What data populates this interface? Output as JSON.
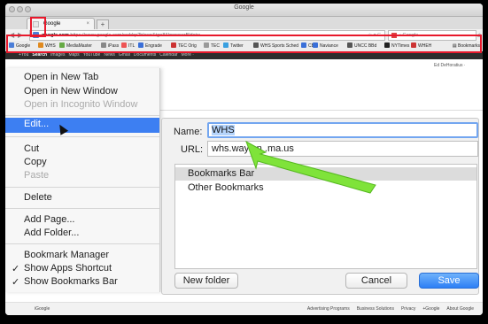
{
  "window": {
    "title": "Google"
  },
  "tabs": [
    {
      "label": "Google",
      "close": "×"
    }
  ],
  "new_tab_label": "+",
  "toolbar": {
    "back": "◀",
    "forward": "▶",
    "url_prefix": "google.com",
    "url_rest": "https://www.google.com/webhp?hl=en&tg=8&browserBld=iw",
    "url_controls": "☆ ▾ C",
    "search_placeholder": "• Google",
    "search_icon": "🔍",
    "home_icon": "⌂"
  },
  "bookmarks": [
    {
      "label": "Google",
      "color": "#4a7ed8"
    },
    {
      "label": "WHS",
      "color": "#e08a1f"
    },
    {
      "label": "MediaMaster",
      "color": "#6a4"
    },
    {
      "label": "iPass",
      "color": "#888"
    },
    {
      "label": "ITL",
      "color": "#e55"
    },
    {
      "label": "Engrade",
      "color": "#3a6fd8"
    },
    {
      "label": "TEC Orig",
      "color": "#c33"
    },
    {
      "label": "TEC",
      "color": "#999"
    },
    {
      "label": "Twitter",
      "color": "#3aa0e0"
    },
    {
      "label": "WHS Sports Sched",
      "color": "#555"
    },
    {
      "label": "CB",
      "color": "#3a6fd8"
    },
    {
      "label": "Naviance",
      "color": "#3a6fd8"
    },
    {
      "label": "UNCC BBd",
      "color": "#555"
    },
    {
      "label": "NYTimes",
      "color": "#222"
    },
    {
      "label": "WHEH",
      "color": "#c33"
    }
  ],
  "bookmarks_all": "Bookmarks",
  "google_bar": [
    "+You",
    "Search",
    "Images",
    "Maps",
    "YouTube",
    "News",
    "Gmail",
    "Documents",
    "Calendar",
    "More ·"
  ],
  "user_name": "Ed DeHoratius ·",
  "context_menu": {
    "open_new_tab": "Open in New Tab",
    "open_new_window": "Open in New Window",
    "open_incognito": "Open in Incognito Window",
    "edit": "Edit...",
    "cut": "Cut",
    "copy": "Copy",
    "paste": "Paste",
    "delete": "Delete",
    "add_page": "Add Page...",
    "add_folder": "Add Folder...",
    "bookmark_manager": "Bookmark Manager",
    "show_apps_shortcut": "Show Apps Shortcut",
    "show_bookmarks_bar": "Show Bookmarks Bar",
    "checkmark": "✓"
  },
  "dialog": {
    "name_label": "Name:",
    "name_value": "WHS",
    "url_label": "URL:",
    "url_value": "whs.waylan                    .ma.us",
    "folders": [
      "Bookmarks Bar",
      "Other Bookmarks"
    ],
    "new_folder": "New folder",
    "cancel": "Cancel",
    "save": "Save"
  },
  "footer": {
    "left": "iGoogle",
    "links": [
      "Advertising Programs",
      "Business Solutions",
      "Privacy",
      "+Google",
      "About Google"
    ]
  },
  "colors": {
    "annotation_red": "#e8192c",
    "arrow_green": "#7fe33a",
    "selection_blue": "#3d7ff2"
  }
}
